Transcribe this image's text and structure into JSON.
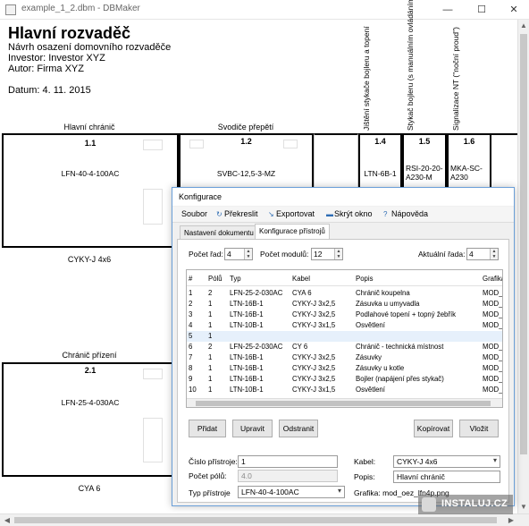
{
  "window": {
    "title": "example_1_2.dbm - DBMaker",
    "minimize": "—",
    "maximize": "☐",
    "close": "✕"
  },
  "document": {
    "title": "Hlavní rozvaděč",
    "subtitle": "Návrh osazení domovního rozvaděče",
    "investor": "Investor: Investor XYZ",
    "author": "Autor: Firma XYZ",
    "date": "Datum: 4. 11. 2015",
    "col_headers": {
      "main_breaker": "Hlavní chránič",
      "surge": "Svodiče přepětí",
      "boiler_fuse": "Jištění stykače bojleru a topení",
      "boiler_contactor": "Stykač bojleru (s manuálním ovládáním)",
      "signal": "Signalizace NT (\"noční proud\")",
      "sub_breaker": "Chránič přízení"
    },
    "cells": [
      {
        "num": "1.1",
        "type": "LFN-40-4-100AC"
      },
      {
        "num": "1.2",
        "type": "SVBC-12,5-3-MZ"
      },
      {
        "num": "1.4",
        "type": "LTN-6B-1"
      },
      {
        "num": "1.5",
        "type": "RSI-20-20-A230-M"
      },
      {
        "num": "1.6",
        "type": "MKA-SC-A230"
      },
      {
        "num": "2.1",
        "type": "LFN-25-4-030AC"
      }
    ],
    "cable_1": "CYKY-J 4x6",
    "cable_2": "CYA 6"
  },
  "dialog": {
    "title": "Konfigurace",
    "menu": [
      {
        "icon": "",
        "label": "Soubor"
      },
      {
        "icon": "↻",
        "label": "Překreslit"
      },
      {
        "icon": "↘",
        "label": "Exportovat"
      },
      {
        "icon": "▬",
        "label": "Skrýt okno"
      },
      {
        "icon": "?",
        "label": "Nápověda"
      }
    ],
    "tabs": [
      "Nastavení dokumentu",
      "Konfigurace přístrojů"
    ],
    "rows_label": "Počet řad:",
    "rows_value": "4",
    "modules_label": "Počet modulů:",
    "modules_value": "12",
    "current_row_label": "Aktuální řada:",
    "current_row_value": "4",
    "grid": {
      "headers": [
        "#",
        "Pólů",
        "Typ",
        "Kabel",
        "Popis",
        "Grafika"
      ],
      "rows": [
        [
          "1",
          "2",
          "LFN-25-2-030AC",
          "CYA 6",
          "Chránič koupelna",
          "MOD_("
        ],
        [
          "2",
          "1",
          "LTN-16B-1",
          "CYKY-J 3x2,5",
          "Zásuvka u umyvadla",
          "MOD_("
        ],
        [
          "3",
          "1",
          "LTN-16B-1",
          "CYKY-J 3x2,5",
          "Podlahové topení + topný žebřík",
          "MOD_("
        ],
        [
          "4",
          "1",
          "LTN-10B-1",
          "CYKY-J 3x1,5",
          "Osvětlení",
          "MOD_("
        ],
        [
          "5",
          "1",
          "",
          "",
          "",
          ""
        ],
        [
          "6",
          "2",
          "LFN-25-2-030AC",
          "CY 6",
          "Chránič - technická místnost",
          "MOD_("
        ],
        [
          "7",
          "1",
          "LTN-16B-1",
          "CYKY-J 3x2,5",
          "Zásuvky",
          "MOD_("
        ],
        [
          "8",
          "1",
          "LTN-16B-1",
          "CYKY-J 3x2,5",
          "Zásuvky u kotle",
          "MOD_("
        ],
        [
          "9",
          "1",
          "LTN-16B-1",
          "CYKY-J 3x2,5",
          "Bojler (napájení přes stykač)",
          "MOD_("
        ],
        [
          "10",
          "1",
          "LTN-10B-1",
          "CYKY-J 3x1,5",
          "Osvětlení",
          "MOD_("
        ]
      ]
    },
    "buttons": {
      "add": "Přidat",
      "edit": "Upravit",
      "delete": "Odstranit",
      "copy": "Kopírovat",
      "paste": "Vložit"
    },
    "form": {
      "device_no_label": "Číslo přístroje:",
      "device_no_value": "1",
      "poles_label": "Počet pólů:",
      "poles_value": "4.0",
      "type_label": "Typ přístroje",
      "type_value": "LFN-40-4-100AC",
      "cable_label": "Kabel:",
      "cable_value": "CYKY-J 4x6",
      "desc_label": "Popis:",
      "desc_value": "Hlavní chránič",
      "graphic_text": "Grafika: mod_oez_lfn4p.png"
    }
  },
  "watermark": "INSTALUJ.CZ"
}
